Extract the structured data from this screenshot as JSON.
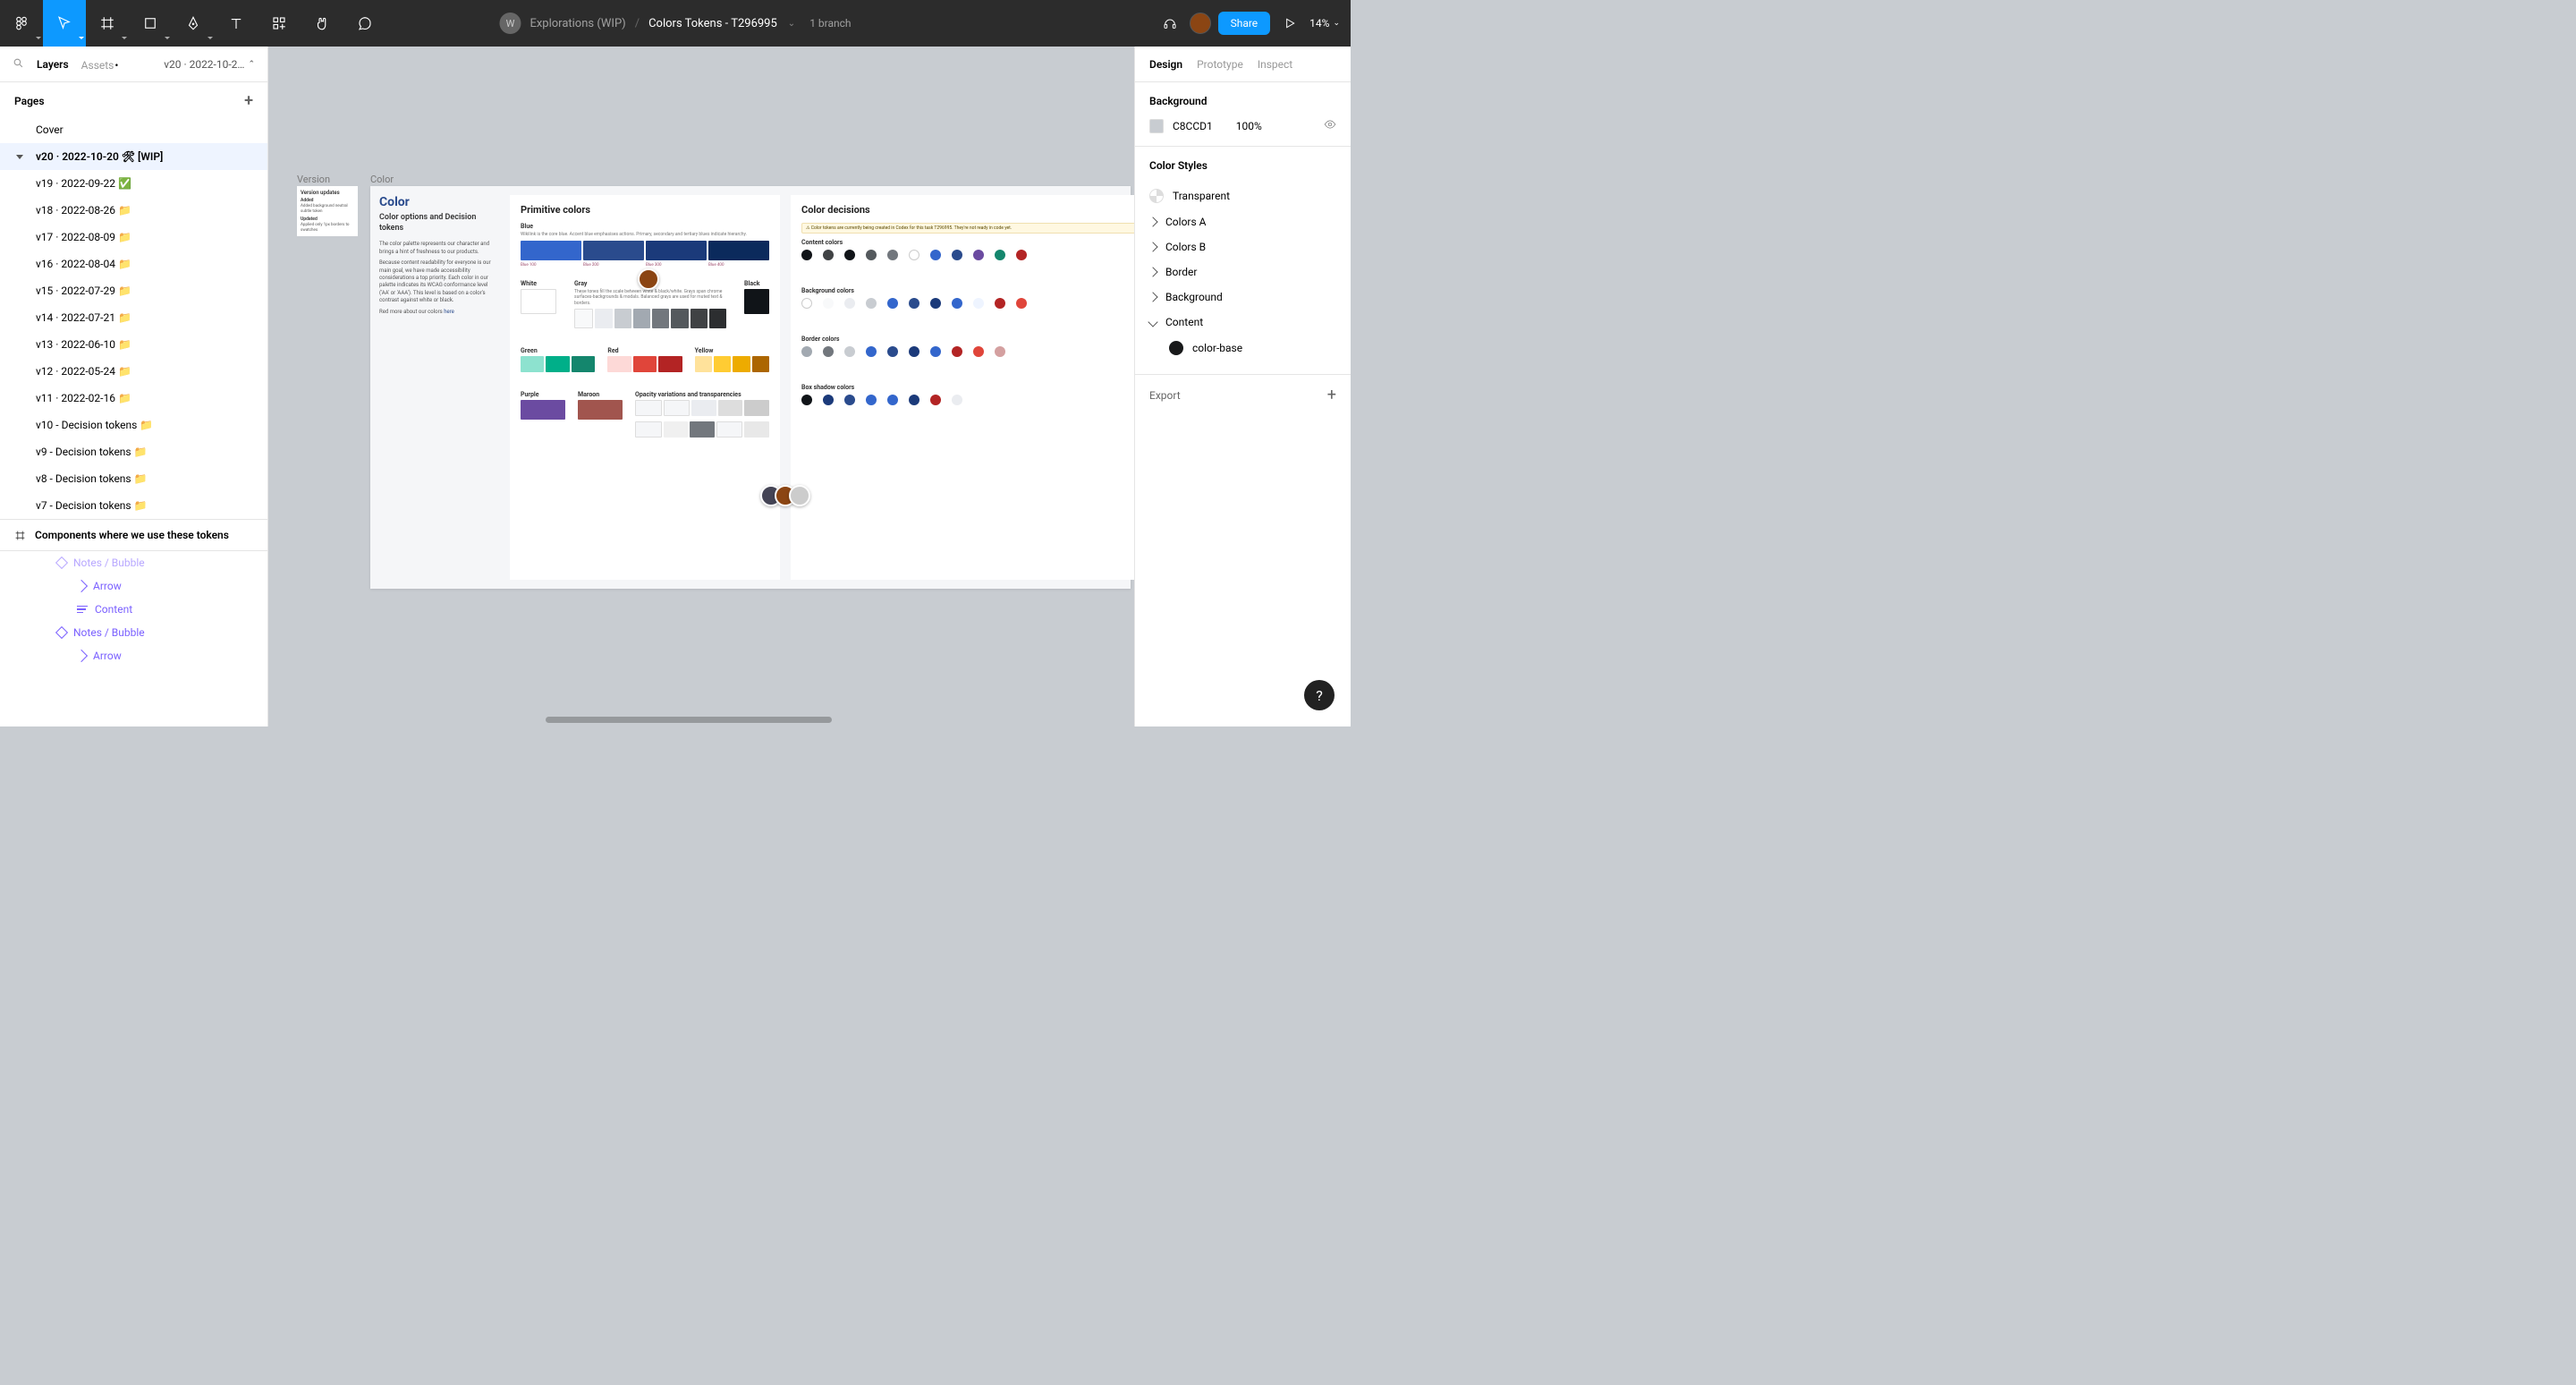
{
  "toolbar": {
    "workspace_initial": "W",
    "project": "Explorations (WIP)",
    "file": "Colors Tokens - T296995",
    "branch": "1 branch",
    "share": "Share",
    "zoom": "14%"
  },
  "left": {
    "tabs": {
      "layers": "Layers",
      "assets": "Assets"
    },
    "page_picker": "v20 · 2022-10-2…",
    "pages_header": "Pages",
    "pages": [
      "Cover",
      "v20  ·  2022-10-20 🛠 [WIP]",
      "v19  ·  2022-09-22 ✅",
      "v18  ·  2022-08-26 📁",
      "v17  ·  2022-08-09 📁",
      "v16  ·  2022-08-04 📁",
      "v15  ·  2022-07-29 📁",
      "v14  ·  2022-07-21 📁",
      "v13  ·  2022-06-10 📁",
      "v12  ·  2022-05-24 📁",
      "v11  ·  2022-02-16 📁",
      "v10 - Decision tokens 📁",
      "v9 - Decision tokens 📁",
      "v8 - Decision tokens 📁",
      "v7 - Decision tokens 📁"
    ],
    "selected_page_idx": 1,
    "components_row": "Components where we use these tokens",
    "layers": [
      {
        "name": "Notes / Bubble",
        "type": "diamond",
        "dim": true
      },
      {
        "name": "Arrow",
        "type": "arrow",
        "sub": true
      },
      {
        "name": "Content",
        "type": "lines",
        "sub": true
      },
      {
        "name": "Notes / Bubble",
        "type": "diamond"
      },
      {
        "name": "Arrow",
        "type": "arrow",
        "sub": true
      }
    ]
  },
  "right": {
    "tabs": {
      "design": "Design",
      "prototype": "Prototype",
      "inspect": "Inspect"
    },
    "bg_title": "Background",
    "bg_hex": "C8CCD1",
    "bg_opacity": "100%",
    "styles_title": "Color Styles",
    "styles": [
      {
        "name": "Transparent",
        "type": "swatch-trans"
      },
      {
        "name": "Colors A",
        "type": "group"
      },
      {
        "name": "Colors B",
        "type": "group"
      },
      {
        "name": "Border",
        "type": "group"
      },
      {
        "name": "Background",
        "type": "group"
      },
      {
        "name": "Content",
        "type": "group-open"
      }
    ],
    "content_child": "color-base",
    "export": "Export"
  },
  "canvas": {
    "labels": {
      "version": "Version",
      "color": "Color"
    },
    "version_card": {
      "title": "Version updates",
      "added": "Added",
      "added_line": "Added background neutral subtle token",
      "updated": "Updated",
      "updated_line": "Applied only 1px borders to swatches"
    },
    "intro": {
      "h1": "Color",
      "h2": "Color options and Decision tokens",
      "p1": "The color palette represents our character and brings a hint of freshness to our products.",
      "p2": "Because content readability for everyone is our main goal, we have made accessibility considerations a top priority. Each color in our palette indicates its WCAG conformance level ('AA' or 'AAA'). This level is based on a color's contrast against white or black.",
      "p3_pre": "Red more about our colors ",
      "p3_link": "here"
    },
    "primitive": {
      "title": "Primitive colors",
      "blue": {
        "label": "Blue",
        "desc": "Wikilink is the core blue. Accent blue emphasises actions. Primary, secondary and tertiary blues indicate hierarchy.",
        "swatches": [
          "#3366cc",
          "#2a4b8d",
          "#1b3a7a",
          "#0b2a5c"
        ],
        "labels": [
          "Blue 100",
          "Blue 200",
          "Blue 300",
          "Blue 400"
        ]
      },
      "white": {
        "label": "White"
      },
      "gray": {
        "label": "Gray",
        "desc": "These tones fill the scale between white & black/white. Grays span chrome surfaces-backgrounds & modals. Balanced grays are used for muted text & borders.",
        "swatches": [
          "#f8f9fa",
          "#eaecf0",
          "#c8ccd1",
          "#a2a9b1",
          "#72777d",
          "#54595d",
          "#404244",
          "#2c2e30"
        ]
      },
      "black": {
        "label": "Black",
        "swatch": "#101418"
      },
      "green": {
        "label": "Green",
        "swatches": [
          "#8de2cf",
          "#00af89",
          "#14866d"
        ]
      },
      "red": {
        "label": "Red",
        "swatches": [
          "#fdd9d7",
          "#e0453a",
          "#b32424"
        ]
      },
      "yellow": {
        "label": "Yellow",
        "swatches": [
          "#ffe29b",
          "#ffcc33",
          "#edab00",
          "#ac6600"
        ]
      },
      "purple": {
        "label": "Purple",
        "swatch": "#6b4ba1"
      },
      "maroon": {
        "label": "Maroon",
        "swatch": "#a1554e"
      },
      "opacity": {
        "label": "Opacity variations and transparencies"
      }
    },
    "decisions": {
      "title": "Color decisions",
      "warning": "⚠ Color tokens are currently being created in Codex for this task T296995. They're not ready in code yet.",
      "sections": {
        "content": {
          "label": "Content colors",
          "dots": [
            "#101418",
            "#404244",
            "#101418",
            "#54595d",
            "#72777d",
            "#ffffff",
            "#3366cc",
            "#2a4b8d",
            "#6b4ba1",
            "#14866d",
            "#b32424"
          ]
        },
        "background": {
          "label": "Background colors",
          "dots": [
            "#ffffff",
            "#f8f9fa",
            "#eaecf0",
            "#c8ccd1",
            "#3366cc",
            "#2a4b8d",
            "#1b3a7a",
            "#3366cc",
            "#eef4ff",
            "#b32424",
            "#e0453a"
          ]
        },
        "border": {
          "label": "Border colors",
          "dots": [
            "#a2a9b1",
            "#72777d",
            "#c8ccd1",
            "#3366cc",
            "#2a4b8d",
            "#1b3a7a",
            "#3366cc",
            "#b32424",
            "#e0453a",
            "#d4a0a0"
          ]
        },
        "shadow": {
          "label": "Box shadow colors",
          "dots": [
            "#101418",
            "#1b3a7a",
            "#2a4b8d",
            "#3366cc",
            "#3366cc",
            "#1b3a7a",
            "#b32424",
            "#eaecf0"
          ]
        }
      }
    }
  },
  "help": "?"
}
